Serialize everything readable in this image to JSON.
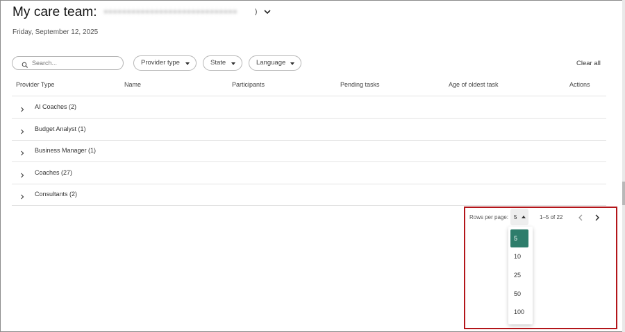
{
  "header": {
    "title": "My care team:",
    "subtitle_redacted": "●●●●●●●●●●●●●●●●●●●●●●●●●●●●●",
    "subtitle_suffix": ")",
    "date": "Friday, September 12, 2025"
  },
  "filters": {
    "search_placeholder": "Search...",
    "provider_type": "Provider type",
    "state": "State",
    "language": "Language",
    "clear_all": "Clear all"
  },
  "table": {
    "columns": [
      "Provider Type",
      "Name",
      "Participants",
      "Pending tasks",
      "Age of oldest task",
      "Actions"
    ],
    "rows": [
      {
        "label": "AI Coaches (2)"
      },
      {
        "label": "Budget Analyst (1)"
      },
      {
        "label": "Business Manager (1)"
      },
      {
        "label": "Coaches (27)"
      },
      {
        "label": "Consultants (2)"
      }
    ]
  },
  "pagination": {
    "rows_per_page_label": "Rows per page:",
    "rows_per_page_value": "5",
    "range": "1–5 of 22",
    "options": [
      "5",
      "10",
      "25",
      "50",
      "100"
    ],
    "selected_option": "5"
  },
  "colors": {
    "selected_option_bg": "#2e7d6b",
    "highlight_border": "#b3151a"
  },
  "icons": {
    "search": "search-icon",
    "row_expand": "chevron-right-icon",
    "title_dropdown": "chevron-down-icon",
    "prev": "chevron-left-icon",
    "next": "chevron-right-icon"
  }
}
